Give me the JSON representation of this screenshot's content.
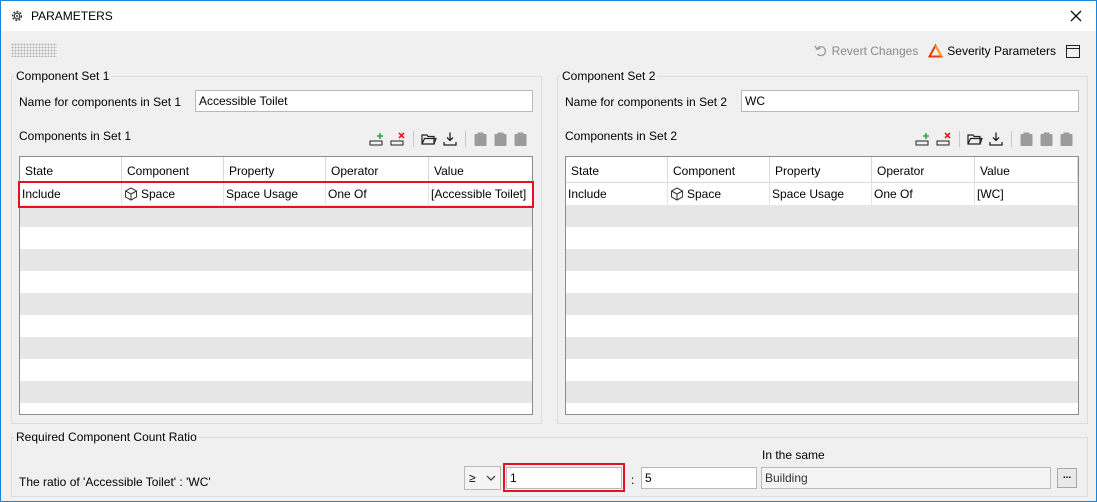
{
  "window": {
    "title": "PARAMETERS"
  },
  "toolbar": {
    "revert_label": "Revert Changes",
    "severity_label": "Severity Parameters"
  },
  "set1": {
    "group_title": "Component Set 1",
    "name_label": "Name for components in Set 1",
    "name_value": "Accessible Toilet",
    "components_label": "Components in Set 1",
    "columns": [
      "State",
      "Component",
      "Property",
      "Operator",
      "Value"
    ],
    "rows": [
      {
        "state": "Include",
        "component": "Space",
        "property": "Space Usage",
        "operator": "One Of",
        "value": "[Accessible Toilet]"
      }
    ]
  },
  "set2": {
    "group_title": "Component Set 2",
    "name_label": "Name for components in Set 2",
    "name_value": "WC",
    "components_label": "Components in Set 2",
    "columns": [
      "State",
      "Component",
      "Property",
      "Operator",
      "Value"
    ],
    "rows": [
      {
        "state": "Include",
        "component": "Space",
        "property": "Space Usage",
        "operator": "One Of",
        "value": "[WC]"
      }
    ]
  },
  "ratio": {
    "group_title": "Required Component Count Ratio",
    "ratio_label": "The ratio of 'Accessible Toilet' : 'WC'",
    "operator": "≥",
    "value_left": "1",
    "separator": ":",
    "value_right": "5",
    "same_label": "In the same",
    "same_value": "Building",
    "ellipsis": "..."
  },
  "colors": {
    "accent": "#1883d7",
    "highlight": "#e81123",
    "add": "#2fa43a",
    "remove": "#e02020"
  }
}
